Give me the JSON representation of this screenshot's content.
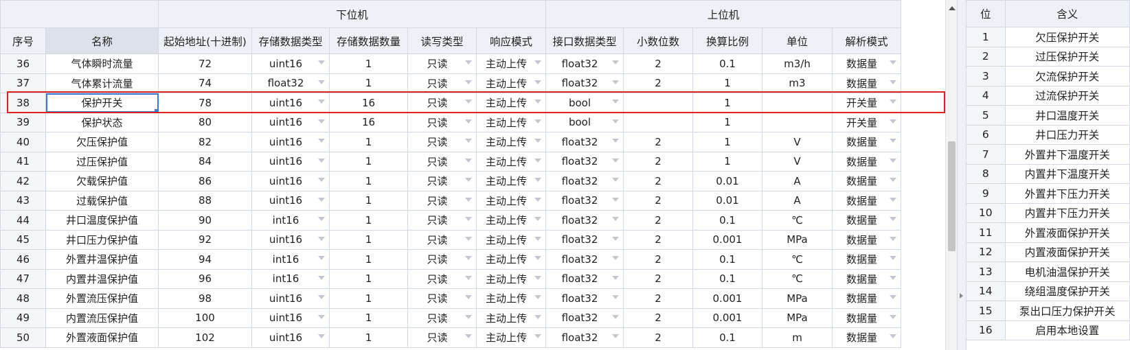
{
  "groups": {
    "lower": "下位机",
    "upper": "上位机"
  },
  "columns": [
    "序号",
    "名称",
    "起始地址(十进制)",
    "存储数据类型",
    "存储数据数量",
    "读写类型",
    "响应模式",
    "接口数据类型",
    "小数位数",
    "换算比例",
    "单位",
    "解析模式"
  ],
  "rows": [
    {
      "seq": "36",
      "name": "气体瞬时流量",
      "addr": "72",
      "stype": "uint16",
      "count": "1",
      "rw": "只读",
      "resp": "主动上传",
      "itype": "float32",
      "dec": "2",
      "scale": "0.1",
      "unit": "m3/h",
      "parse": "数据量"
    },
    {
      "seq": "37",
      "name": "气体累计流量",
      "addr": "74",
      "stype": "float32",
      "count": "1",
      "rw": "只读",
      "resp": "主动上传",
      "itype": "float32",
      "dec": "2",
      "scale": "1",
      "unit": "m3",
      "parse": "数据量"
    },
    {
      "seq": "38",
      "name": "保护开关",
      "addr": "78",
      "stype": "uint16",
      "count": "16",
      "rw": "只读",
      "resp": "主动上传",
      "itype": "bool",
      "dec": "",
      "scale": "1",
      "unit": "",
      "parse": "开关量"
    },
    {
      "seq": "39",
      "name": "保护状态",
      "addr": "80",
      "stype": "uint16",
      "count": "16",
      "rw": "只读",
      "resp": "主动上传",
      "itype": "bool",
      "dec": "",
      "scale": "1",
      "unit": "",
      "parse": "开关量"
    },
    {
      "seq": "40",
      "name": "欠压保护值",
      "addr": "82",
      "stype": "uint16",
      "count": "1",
      "rw": "只读",
      "resp": "主动上传",
      "itype": "float32",
      "dec": "2",
      "scale": "1",
      "unit": "V",
      "parse": "数据量"
    },
    {
      "seq": "41",
      "name": "过压保护值",
      "addr": "84",
      "stype": "uint16",
      "count": "1",
      "rw": "只读",
      "resp": "主动上传",
      "itype": "float32",
      "dec": "2",
      "scale": "1",
      "unit": "V",
      "parse": "数据量"
    },
    {
      "seq": "42",
      "name": "欠载保护值",
      "addr": "86",
      "stype": "uint16",
      "count": "1",
      "rw": "只读",
      "resp": "主动上传",
      "itype": "float32",
      "dec": "2",
      "scale": "0.01",
      "unit": "A",
      "parse": "数据量"
    },
    {
      "seq": "43",
      "name": "过载保护值",
      "addr": "88",
      "stype": "uint16",
      "count": "1",
      "rw": "只读",
      "resp": "主动上传",
      "itype": "float32",
      "dec": "2",
      "scale": "0.01",
      "unit": "A",
      "parse": "数据量"
    },
    {
      "seq": "44",
      "name": "井口温度保护值",
      "addr": "90",
      "stype": "int16",
      "count": "1",
      "rw": "只读",
      "resp": "主动上传",
      "itype": "float32",
      "dec": "2",
      "scale": "0.1",
      "unit": "℃",
      "parse": "数据量"
    },
    {
      "seq": "45",
      "name": "井口压力保护值",
      "addr": "92",
      "stype": "uint16",
      "count": "1",
      "rw": "只读",
      "resp": "主动上传",
      "itype": "float32",
      "dec": "2",
      "scale": "0.001",
      "unit": "MPa",
      "parse": "数据量"
    },
    {
      "seq": "46",
      "name": "外置井温保护值",
      "addr": "94",
      "stype": "int16",
      "count": "1",
      "rw": "只读",
      "resp": "主动上传",
      "itype": "float32",
      "dec": "2",
      "scale": "0.1",
      "unit": "℃",
      "parse": "数据量"
    },
    {
      "seq": "47",
      "name": "内置井温保护值",
      "addr": "96",
      "stype": "int16",
      "count": "1",
      "rw": "只读",
      "resp": "主动上传",
      "itype": "float32",
      "dec": "2",
      "scale": "0.1",
      "unit": "℃",
      "parse": "数据量"
    },
    {
      "seq": "48",
      "name": "外置流压保护值",
      "addr": "98",
      "stype": "uint16",
      "count": "1",
      "rw": "只读",
      "resp": "主动上传",
      "itype": "float32",
      "dec": "2",
      "scale": "0.001",
      "unit": "MPa",
      "parse": "数据量"
    },
    {
      "seq": "49",
      "name": "内置流压保护值",
      "addr": "100",
      "stype": "uint16",
      "count": "1",
      "rw": "只读",
      "resp": "主动上传",
      "itype": "float32",
      "dec": "2",
      "scale": "0.001",
      "unit": "MPa",
      "parse": "数据量"
    },
    {
      "seq": "50",
      "name": "外置液面保护值",
      "addr": "102",
      "stype": "uint16",
      "count": "1",
      "rw": "只读",
      "resp": "主动上传",
      "itype": "float32",
      "dec": "2",
      "scale": "0.1",
      "unit": "m",
      "parse": "数据量"
    }
  ],
  "side": {
    "headers": [
      "位",
      "含义"
    ],
    "rows": [
      {
        "bit": "1",
        "meaning": "欠压保护开关"
      },
      {
        "bit": "2",
        "meaning": "过压保护开关"
      },
      {
        "bit": "3",
        "meaning": "欠流保护开关"
      },
      {
        "bit": "4",
        "meaning": "过流保护开关"
      },
      {
        "bit": "5",
        "meaning": "井口温度开关"
      },
      {
        "bit": "6",
        "meaning": "井口压力开关"
      },
      {
        "bit": "7",
        "meaning": "外置井下温度开关"
      },
      {
        "bit": "8",
        "meaning": "内置井下温度开关"
      },
      {
        "bit": "9",
        "meaning": "外置井下压力开关"
      },
      {
        "bit": "10",
        "meaning": "内置井下压力开关"
      },
      {
        "bit": "11",
        "meaning": "外置液面保护开关"
      },
      {
        "bit": "12",
        "meaning": "内置液面保护开关"
      },
      {
        "bit": "13",
        "meaning": "电机油温保护开关"
      },
      {
        "bit": "14",
        "meaning": "绕组温度保护开关"
      },
      {
        "bit": "15",
        "meaning": "泵出口压力保护开关"
      },
      {
        "bit": "16",
        "meaning": "启用本地设置"
      }
    ]
  },
  "selected_row": "38",
  "colors": {
    "highlight": "#e02020",
    "selection": "#3a7bd5",
    "header_bg": "#eef2f7"
  }
}
